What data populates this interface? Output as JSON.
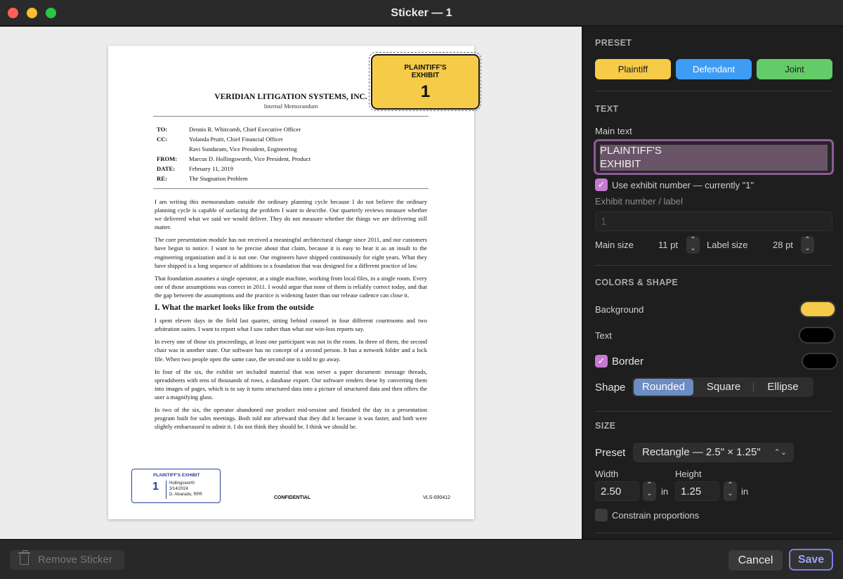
{
  "window": {
    "title": "Sticker — 1"
  },
  "document": {
    "company": "VERIDIAN LITIGATION SYSTEMS, INC.",
    "subtitle": "Internal Memorandum",
    "memo": [
      {
        "label": "TO:",
        "value": "Dennis R. Whitcomb, Chief Executive Officer"
      },
      {
        "label": "CC:",
        "value": "Yolanda Pruitt, Chief Financial Officer"
      },
      {
        "label": "",
        "value": "Ravi Sundaram, Vice President, Engineering"
      },
      {
        "label": "FROM:",
        "value": "Marcus D. Hollingsworth, Vice President, Product"
      },
      {
        "label": "DATE:",
        "value": "February 11, 2019"
      },
      {
        "label": "RE:",
        "value": "The Stagnation Problem"
      }
    ],
    "paragraphs": [
      "I am writing this memorandum outside the ordinary planning cycle because I do not believe the ordinary planning cycle is capable of surfacing the problem I want to describe. Our quarterly reviews measure whether we delivered what we said we would deliver. They do not measure whether the things we are delivering still matter.",
      "The core presentation module has not received a meaningful architectural change since 2011, and our customers have begun to notice. I want to be precise about that claim, because it is easy to hear it as an insult to the engineering organization and it is not one. Our engineers have shipped continuously for eight years. What they have shipped is a long sequence of additions to a foundation that was designed for a different practice of law.",
      "That foundation assumes a single operator, at a single machine, working from local files, in a single room. Every one of those assumptions was correct in 2011. I would argue that none of them is reliably correct today, and that the gap between the assumptions and the practice is widening faster than our release cadence can close it."
    ],
    "heading": "I. What the market looks like from the outside",
    "paragraphs2": [
      "I spent eleven days in the field last quarter, sitting behind counsel in four different courtrooms and two arbitration suites. I want to report what I saw rather than what our win-loss reports say.",
      "In every one of those six proceedings, at least one participant was not in the room. In three of them, the second chair was in another state. Our software has no concept of a second person. It has a network folder and a lock file. When two people open the same case, the second one is told to go away.",
      "In four of the six, the exhibit set included material that was never a paper document: message threads, spreadsheets with tens of thousands of rows, a database export. Our software renders these by converting them into images of pages, which is to say it turns structured data into a picture of structured data and then offers the user a magnifying glass.",
      "In two of the six, the operator abandoned our product mid-session and finished the day in a presentation program built for sales meetings. Both told me afterward that they did it because it was faster, and both were slightly embarrassed to admit it. I do not think they should be. I think we should be."
    ],
    "stamp": {
      "title": "PLAINTIFF'S EXHIBIT",
      "number": "1",
      "line1": "Hollingsworth",
      "line2": "3/14/2024",
      "line3": "D. Alvarado, RPR"
    },
    "footer_center": "CONFIDENTIAL",
    "footer_id": "VLS-000412"
  },
  "sticker": {
    "main_text": "PLAINTIFF'S\nEXHIBIT",
    "number": "1",
    "background": "#f6cb48",
    "text_color": "#111111",
    "border_color": "#1a1a1a"
  },
  "inspector": {
    "preset": {
      "heading": "PRESET",
      "plaintiff": "Plaintiff",
      "defendant": "Defendant",
      "joint": "Joint"
    },
    "text": {
      "heading": "TEXT",
      "main_label": "Main text",
      "main_value": "PLAINTIFF'S\nEXHIBIT",
      "use_number": "Use exhibit number — currently \"1\"",
      "number_label": "Exhibit number / label",
      "number_value": "1",
      "main_size_label": "Main size",
      "main_size_value": "11 pt",
      "label_size_label": "Label size",
      "label_size_value": "28 pt"
    },
    "colors": {
      "heading": "COLORS & SHAPE",
      "background_label": "Background",
      "text_label": "Text",
      "border_label": "Border",
      "background": "#f6cb48",
      "text": "#000000",
      "border": "#000000",
      "shape_label": "Shape",
      "shape_options": [
        "Rounded",
        "Square",
        "Ellipse"
      ]
    },
    "size": {
      "heading": "SIZE",
      "preset_label": "Preset",
      "preset_value": "Rectangle — 2.5\" × 1.25\"",
      "width_label": "Width",
      "width_value": "2.50",
      "height_label": "Height",
      "height_value": "1.25",
      "unit": "in",
      "constrain": "Constrain proportions"
    }
  },
  "footer": {
    "remove": "Remove Sticker",
    "cancel": "Cancel",
    "save": "Save"
  }
}
